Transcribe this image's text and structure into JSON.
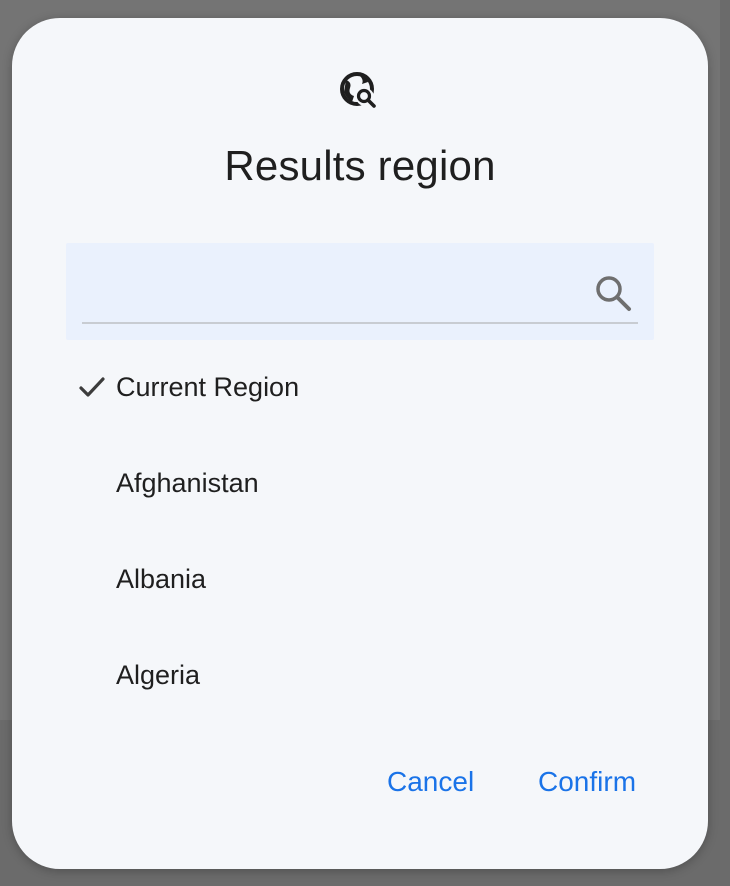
{
  "dialog": {
    "icon": "globe-search-icon",
    "title": "Results region",
    "search": {
      "value": "",
      "placeholder": "",
      "icon": "search-icon"
    },
    "regions": [
      {
        "label": "Current Region",
        "selected": true
      },
      {
        "label": "Afghanistan",
        "selected": false
      },
      {
        "label": "Albania",
        "selected": false
      },
      {
        "label": "Algeria",
        "selected": false
      }
    ],
    "actions": {
      "cancel_label": "Cancel",
      "confirm_label": "Confirm"
    }
  },
  "colors": {
    "accent": "#1a73e8",
    "dialog_bg": "#f5f7fa",
    "search_bg": "#eaf1fd",
    "text": "#1f1f1f"
  }
}
